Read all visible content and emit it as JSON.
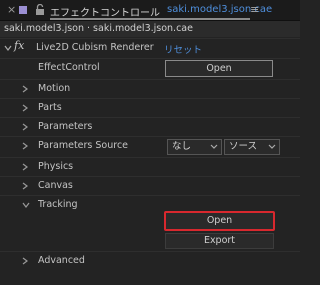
{
  "tab": {
    "close_glyph": "×",
    "title": "エフェクトコントロール",
    "file": "saki.model3.json.cae",
    "menu_glyph": "≡",
    "swatch_color": "#9b8fd3"
  },
  "breadcrumb": "saki.model3.json · saki.model3.json.cae",
  "effect": {
    "fx_label": "fx",
    "name": "Live2D Cubism Renderer",
    "reset_label": "リセット"
  },
  "properties": [
    {
      "label": "EffectControl"
    },
    {
      "label": "Motion"
    },
    {
      "label": "Parts"
    },
    {
      "label": "Parameters"
    },
    {
      "label": "Parameters Source"
    },
    {
      "label": "Physics"
    },
    {
      "label": "Canvas"
    },
    {
      "label": "Tracking"
    },
    {
      "label": "Advanced"
    }
  ],
  "buttons": {
    "effect_control_open": "Open",
    "tracking_open": "Open",
    "tracking_export": "Export"
  },
  "params_source": {
    "select1": "なし",
    "select2": "ソース"
  },
  "colors": {
    "accent_link": "#4f8fdc",
    "focus_outline": "#d8282e"
  }
}
